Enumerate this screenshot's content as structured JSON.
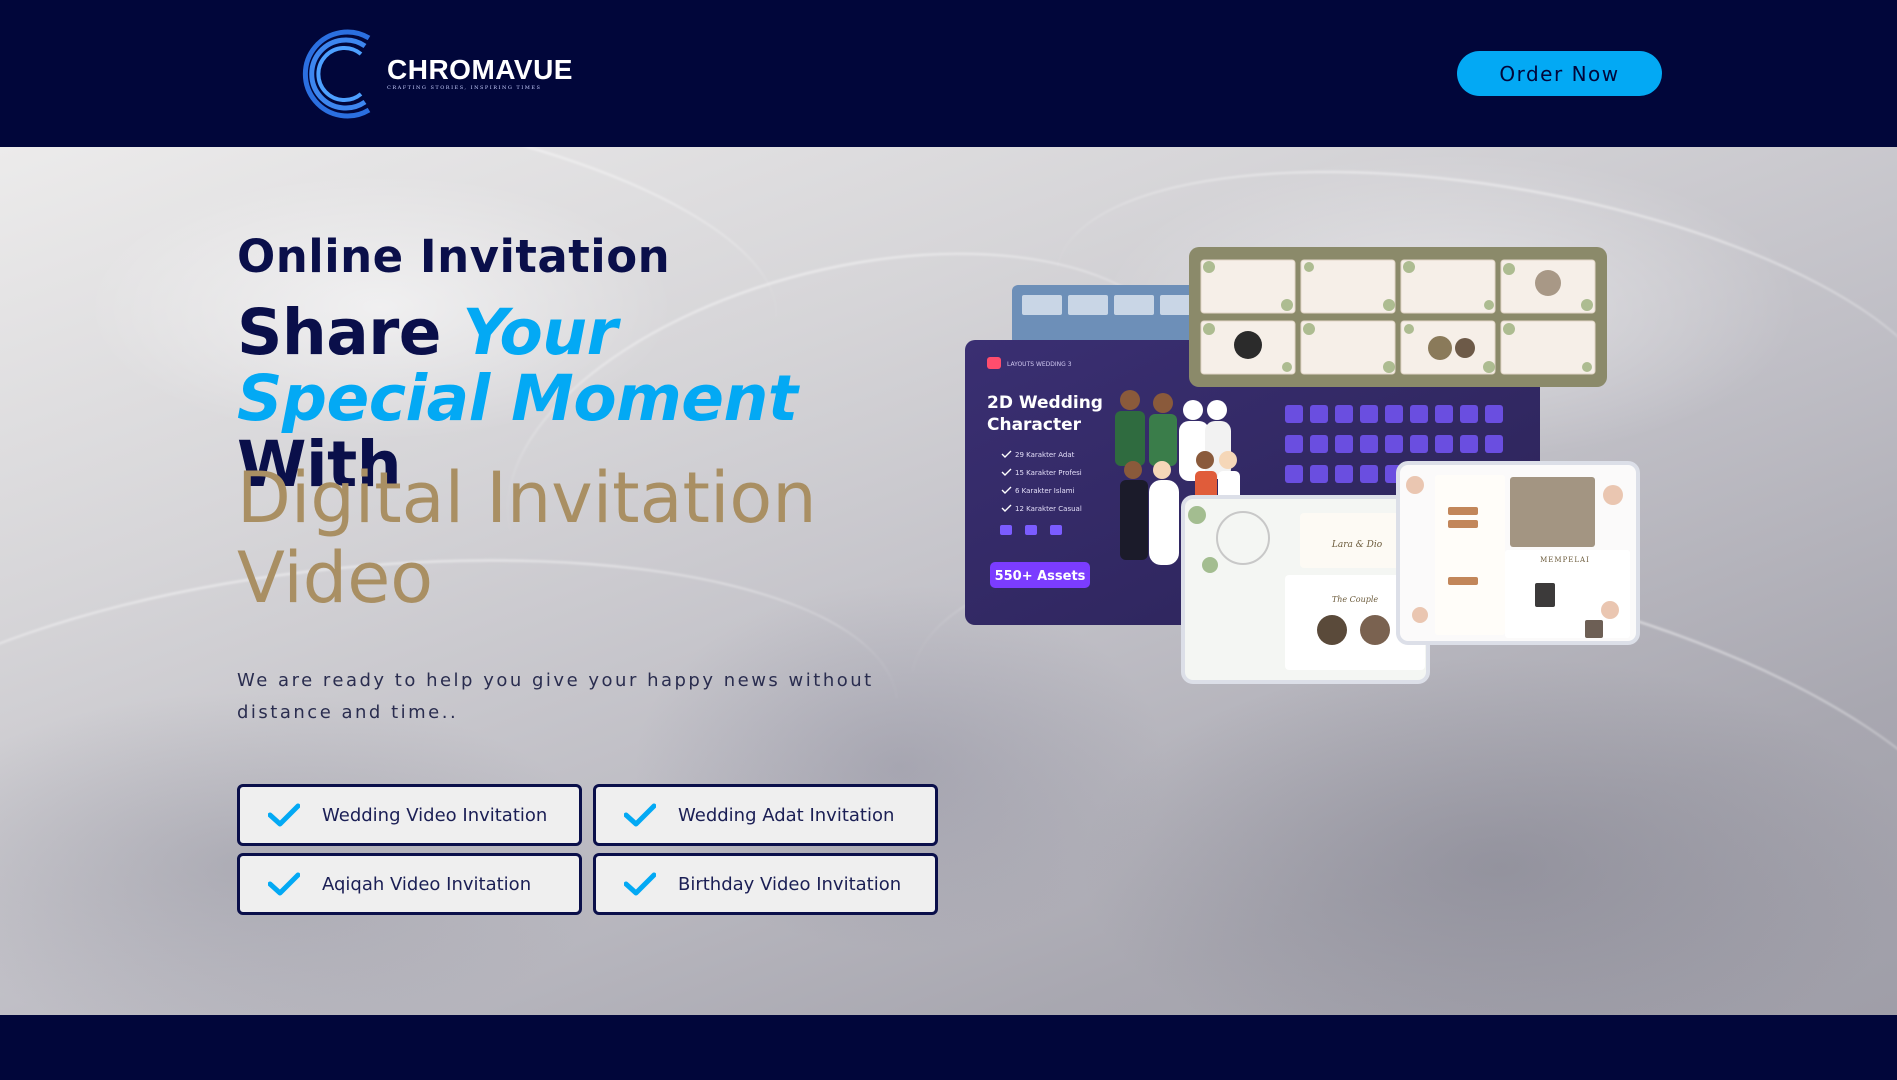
{
  "header": {
    "logo_name": "CHROMAVUE",
    "logo_tagline": "CRAFTING STORIES, INSPIRING TIMES",
    "order_button": "Order Now"
  },
  "hero": {
    "pre_title": "Online Invitation",
    "headline_part1": "Share ",
    "headline_accent": "Your Special Moment",
    "headline_part2": " With",
    "gold_title": "Digital Invitation Video",
    "description": "We are ready to help you give your happy news without distance and time..",
    "features": [
      "Wedding Video Invitation",
      "Wedding Adat Invitation",
      "Aqiqah Video Invitation",
      "Birthday Video Invitation"
    ]
  },
  "mockup": {
    "brand": "LAYOUTS WEDDING 3",
    "title_line1": "2D Wedding",
    "title_line2": "Character",
    "list": [
      "29 Karakter Adat",
      "15 Karakter Profesi",
      "6 Karakter Islami",
      "12 Karakter Casual"
    ],
    "assets_badge": "550+ Assets",
    "card_names": [
      "Lara & Dio",
      "The Couple",
      "MEMPELAI"
    ]
  },
  "colors": {
    "navy": "#01063a",
    "accent": "#03a9f4",
    "gold": "#a98f63"
  }
}
